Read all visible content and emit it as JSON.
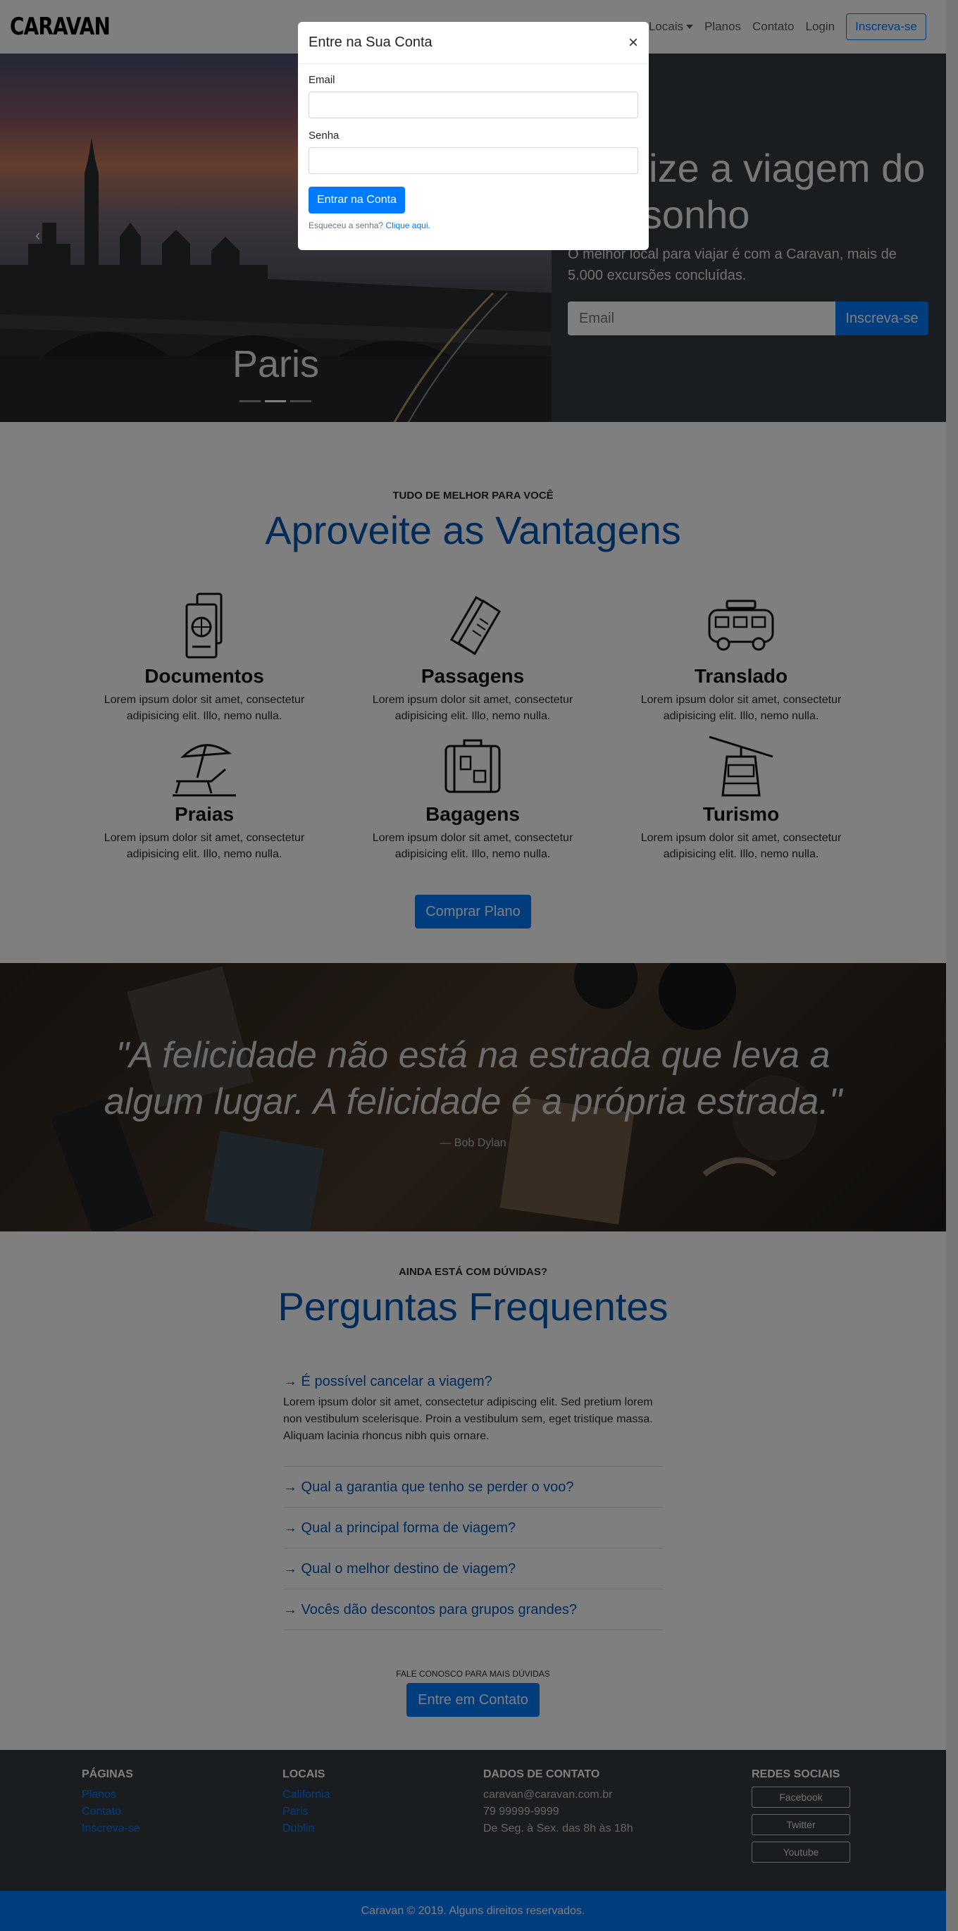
{
  "navbar": {
    "brand": "CARAVAN",
    "links": [
      "Locais",
      "Planos",
      "Contato",
      "Login"
    ],
    "cta": "Inscreva-se"
  },
  "hero": {
    "carousel_caption": "Paris",
    "title": "Realize a viagem do seu sonho",
    "subtitle": "O melhor local para viajar é com a Caravan, mais de 5.000 excursões concluídas.",
    "email_placeholder": "Email",
    "submit": "Inscreva-se"
  },
  "vantagens": {
    "eyebrow": "TUDO DE MELHOR PARA VOCÊ",
    "title": "Aproveite as Vantagens",
    "items": [
      {
        "title": "Documentos",
        "text": "Lorem ipsum dolor sit amet, consectetur adipisicing elit. Illo, nemo nulla.",
        "icon": "passport-icon"
      },
      {
        "title": "Passagens",
        "text": "Lorem ipsum dolor sit amet, consectetur adipisicing elit. Illo, nemo nulla.",
        "icon": "tickets-icon"
      },
      {
        "title": "Translado",
        "text": "Lorem ipsum dolor sit amet, consectetur adipisicing elit. Illo, nemo nulla.",
        "icon": "van-icon"
      },
      {
        "title": "Praias",
        "text": "Lorem ipsum dolor sit amet, consectetur adipisicing elit. Illo, nemo nulla.",
        "icon": "beach-icon"
      },
      {
        "title": "Bagagens",
        "text": "Lorem ipsum dolor sit amet, consectetur adipisicing elit. Illo, nemo nulla.",
        "icon": "luggage-icon"
      },
      {
        "title": "Turismo",
        "text": "Lorem ipsum dolor sit amet, consectetur adipisicing elit. Illo, nemo nulla.",
        "icon": "cable-car-icon"
      }
    ],
    "button": "Comprar Plano"
  },
  "quote": {
    "text": "\"A felicidade não está na estrada que leva a algum lugar. A felicidade é a própria estrada.\"",
    "author": "— Bob Dylan"
  },
  "faq": {
    "eyebrow": "AINDA ESTÁ COM DÚVIDAS?",
    "title": "Perguntas Frequentes",
    "items": [
      {
        "q": "→ É possível cancelar a viagem?",
        "a": "Lorem ipsum dolor sit amet, consectetur adipiscing elit. Sed pretium lorem non vestibulum scelerisque. Proin a vestibulum sem, eget tristique massa. Aliquam lacinia rhoncus nibh quis ornare."
      },
      {
        "q": "→ Qual a garantia que tenho se perder o voo?"
      },
      {
        "q": "→ Qual a principal forma de viagem?"
      },
      {
        "q": "→ Qual o melhor destino de viagem?"
      },
      {
        "q": "→ Vocês dão descontos para grupos grandes?"
      }
    ],
    "contact_eyebrow": "FALE CONOSCO PARA MAIS DÚVIDAS",
    "contact_button": "Entre em Contato"
  },
  "footer": {
    "paginas": {
      "title": "PÁGINAS",
      "links": [
        "Planos",
        "Contato",
        "Inscreva-se"
      ]
    },
    "locais": {
      "title": "LOCAIS",
      "links": [
        "California",
        "Paris",
        "Dublin"
      ]
    },
    "contato": {
      "title": "DADOS DE CONTATO",
      "lines": [
        "caravan@caravan.com.br",
        "79 99999-9999",
        "De Seg. à Sex. das 8h às 18h"
      ]
    },
    "redes": {
      "title": "REDES SOCIAIS",
      "links": [
        "Facebook",
        "Twitter",
        "Youtube"
      ]
    },
    "copyright": "Caravan © 2019. Alguns direitos reservados."
  },
  "modal": {
    "title": "Entre na Sua Conta",
    "close": "×",
    "email_label": "Email",
    "password_label": "Senha",
    "submit": "Entrar na Conta",
    "forgot": "Esqueceu a senha?",
    "forgot_link": "Clique aqui."
  }
}
